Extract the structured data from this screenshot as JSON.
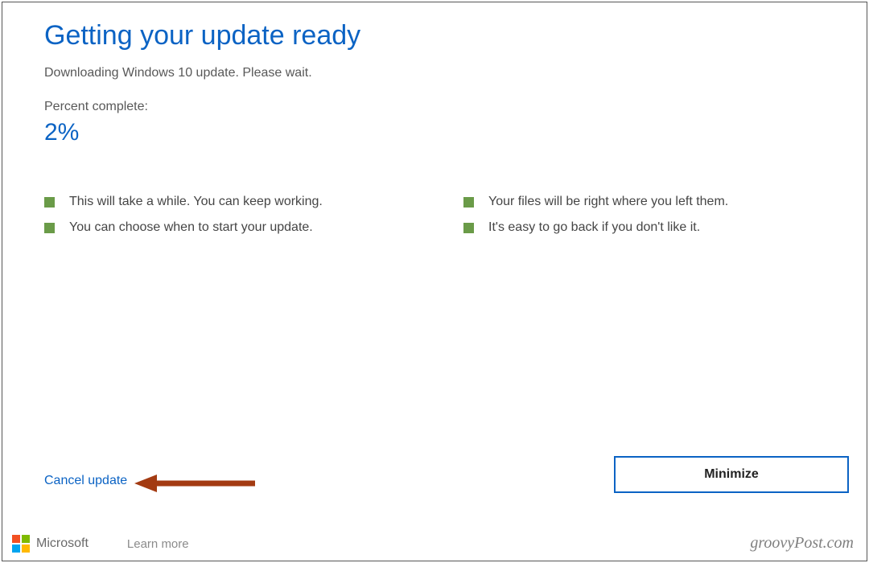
{
  "title": "Getting your update ready",
  "message": "Downloading Windows 10 update. Please wait.",
  "percent_label": "Percent complete:",
  "percent_value": "2%",
  "bullets": {
    "left": [
      "This will take a while. You can keep working.",
      "You can choose when to start your update."
    ],
    "right": [
      "Your files will be right where you left them.",
      "It's easy to go back if you don't like it."
    ]
  },
  "actions": {
    "cancel": "Cancel update",
    "minimize": "Minimize"
  },
  "footer": {
    "brand": "Microsoft",
    "learn_more": "Learn more"
  },
  "watermark": "groovyPost.com",
  "colors": {
    "accent": "#0b63c4",
    "bullet": "#6a9b48",
    "arrow": "#a33b12"
  }
}
